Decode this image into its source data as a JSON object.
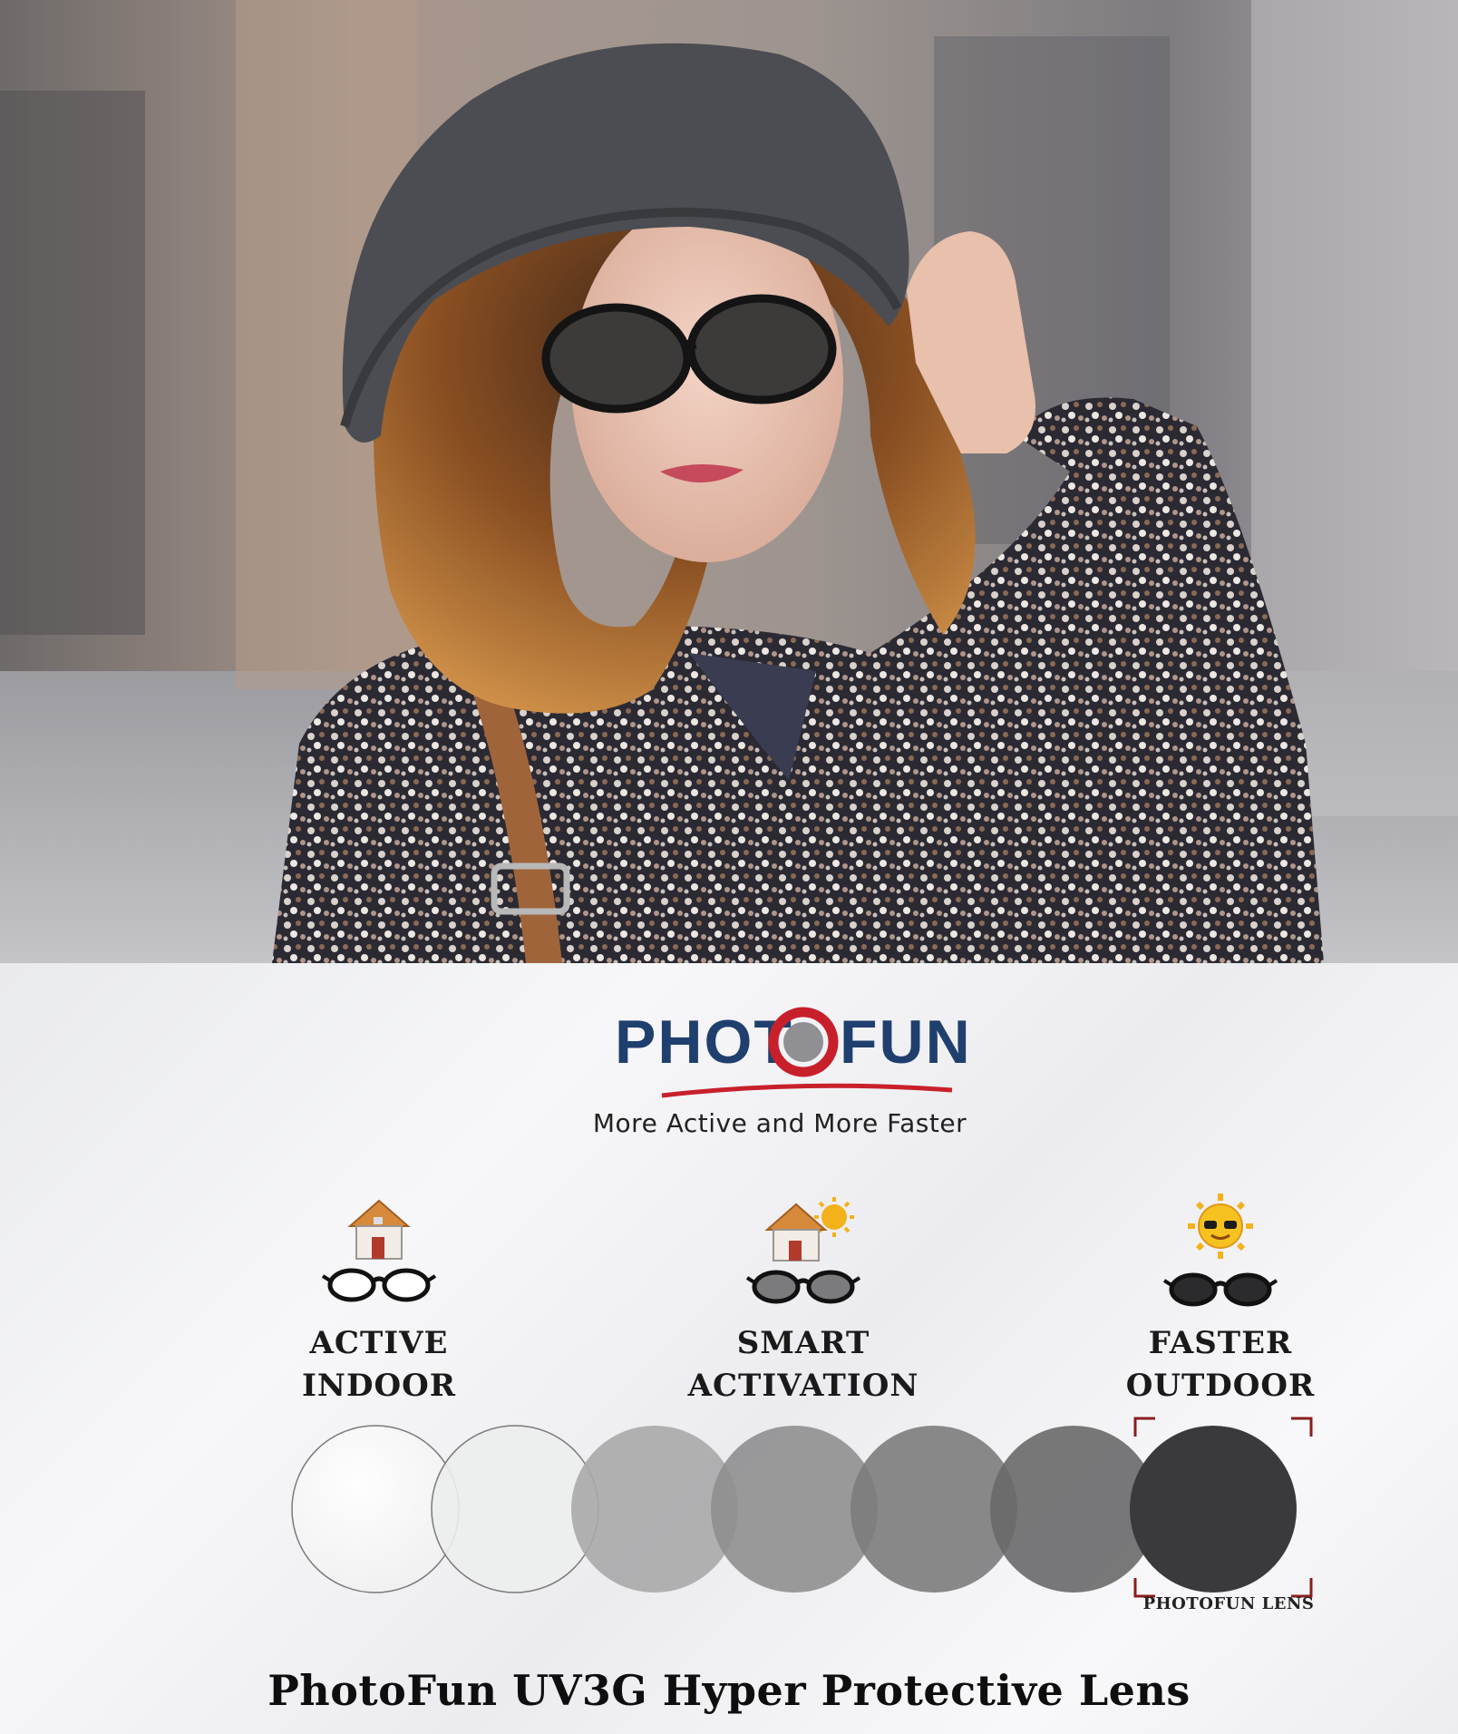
{
  "brand": {
    "logo_text": "PHOTOFUN",
    "tagline": "More Active and More Faster",
    "navy": "#1f3f6e",
    "red": "#c8202b"
  },
  "features": [
    {
      "icon": "house-glasses-icon",
      "line1": "ACTIVE",
      "line2": "INDOOR"
    },
    {
      "icon": "house-sun-tinted-glasses-icon",
      "line1": "SMART",
      "line2": "ACTIVATION"
    },
    {
      "icon": "sun-dark-glasses-icon",
      "line1": "FASTER",
      "line2": "OUTDOOR"
    }
  ],
  "lens_scale": {
    "tints": [
      "#ffffff",
      "#eceded",
      "#a9a9aa",
      "#8f8f90",
      "#7c7c7d",
      "#69696a",
      "#3a3a3c"
    ],
    "highlighted_caption": "PHOTOFUN LENS"
  },
  "headline": "PhotoFun UV3G Hyper Protective Lens"
}
